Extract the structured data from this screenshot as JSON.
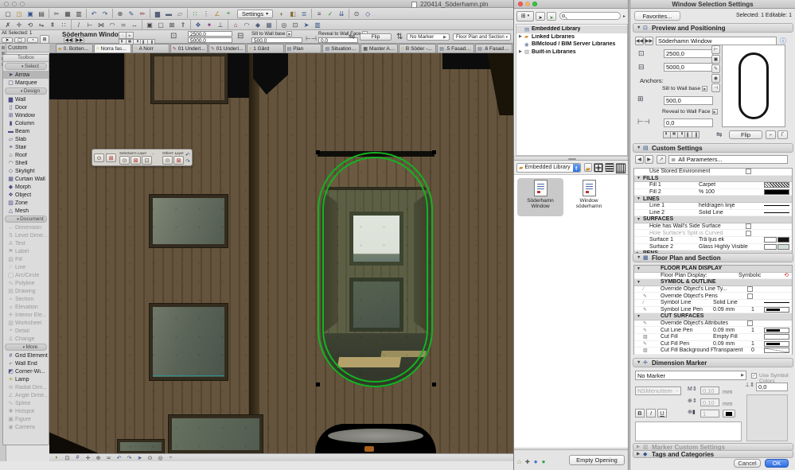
{
  "window": {
    "title": "220414_Söderhamn.pln",
    "settings_label": "Settings"
  },
  "toolbar_row1": [
    "new-file-icon",
    "open-file-icon",
    "save-icon",
    "print-icon",
    "separator",
    "cut-icon",
    "copy-icon",
    "paste-icon",
    "separator",
    "undo-icon",
    "redo-icon",
    "separator",
    "zoom-icon",
    "pick-up-parameters-icon",
    "inject-parameters-icon",
    "separator",
    "wall-tool-dropdown-icon",
    "beam-tool-dropdown-icon",
    "slab-tool-dropdown-icon",
    "separator",
    "snap-points-icon",
    "snap-guides-icon",
    "guide-lines-icon",
    "element-snap-icon"
  ],
  "toolbar_row1b": [
    "virtual-trace-icon",
    "trace-reference-icon",
    "layers-dialog-icon",
    "separator",
    "quick-options-icon",
    "green-check-icon",
    "teamwork-receive-icon",
    "separator",
    "find-select-icon",
    "3d-view-icon"
  ],
  "toolbar_row2": [
    "delete-icon",
    "drag-icon",
    "rotate-icon",
    "mirror-icon",
    "elevate-icon",
    "multiply-icon",
    "separator",
    "split-icon",
    "adjust-icon",
    "intersect-icon",
    "fillet-icon",
    "offset-icon",
    "stretch-icon",
    "separator",
    "group-icon",
    "ungroup-icon",
    "lock-icon",
    "bring-forward-icon",
    "separator",
    "pet-palette-icon",
    "magic-wand-icon",
    "gravity-icon",
    "separator",
    "roof-tool-icon",
    "shell-tool-icon",
    "morph-tool-icon",
    "curtain-wall-tool-icon",
    "separator",
    "show-all-icon",
    "zoom-fit-icon",
    "navigator-icon",
    "organizer-icon"
  ],
  "info_bar": {
    "selected_info": "All Selected: 1",
    "element_name": "Söderhamn Window",
    "width_value": "2500.0",
    "height_value": "5000.0",
    "sill_label": "Sill to Wall base",
    "sill_value": "500.0",
    "reveal_label": "Reveal to Wall Face",
    "reveal_value": "0.0",
    "flip_label": "Flip",
    "marker_value": "No Marker",
    "view_value": "Floor Plan and Section"
  },
  "tabs": [
    {
      "label": "0. Botten...",
      "icon": "folder-icon"
    },
    {
      "label": "Norra fas...",
      "icon": "house-icon",
      "active": true
    },
    {
      "label": "A Norr",
      "icon": "house-icon"
    },
    {
      "label": "01 Underl...",
      "icon": "pencil-icon"
    },
    {
      "label": "01 Underl...",
      "icon": "pencil-icon"
    },
    {
      "label": "1 Gård",
      "icon": "house-icon"
    },
    {
      "label": "Plan",
      "icon": "layout-icon"
    },
    {
      "label": "Situations...",
      "icon": "layout-icon"
    },
    {
      "label": "Master A3...",
      "icon": "master-icon"
    },
    {
      "label": "B Söder -...",
      "icon": "house-icon"
    },
    {
      "label": ".5 Fasad -...",
      "icon": "layout-icon"
    },
    {
      "label": ".6 Fasad -...",
      "icon": "layout-icon"
    }
  ],
  "toolbox": {
    "dock_header": "Custom",
    "panel_title": "Toolbox",
    "rows": [
      {
        "type": "section",
        "label": "Select"
      },
      {
        "type": "tool",
        "label": "Arrow",
        "icon": "arrow-icon",
        "selected": true
      },
      {
        "type": "tool",
        "label": "Marquee",
        "icon": "marquee-icon"
      },
      {
        "type": "section",
        "label": "Design"
      },
      {
        "type": "tool",
        "label": "Wall",
        "icon": "wall-icon"
      },
      {
        "type": "tool",
        "label": "Door",
        "icon": "door-icon"
      },
      {
        "type": "tool",
        "label": "Window",
        "icon": "window-icon"
      },
      {
        "type": "tool",
        "label": "Column",
        "icon": "column-icon"
      },
      {
        "type": "tool",
        "label": "Beam",
        "icon": "beam-icon"
      },
      {
        "type": "tool",
        "label": "Slab",
        "icon": "slab-icon"
      },
      {
        "type": "tool",
        "label": "Stair",
        "icon": "stair-icon"
      },
      {
        "type": "tool",
        "label": "Roof",
        "icon": "roof-icon"
      },
      {
        "type": "tool",
        "label": "Shell",
        "icon": "shell-icon"
      },
      {
        "type": "tool",
        "label": "Skylight",
        "icon": "skylight-icon"
      },
      {
        "type": "tool",
        "label": "Curtain Wall",
        "icon": "curtain-wall-icon"
      },
      {
        "type": "tool",
        "label": "Morph",
        "icon": "morph-icon"
      },
      {
        "type": "tool",
        "label": "Object",
        "icon": "object-icon"
      },
      {
        "type": "tool",
        "label": "Zone",
        "icon": "zone-icon"
      },
      {
        "type": "tool",
        "label": "Mesh",
        "icon": "mesh-icon"
      },
      {
        "type": "section",
        "label": "Document"
      },
      {
        "type": "tool",
        "label": "Dimension",
        "icon": "dimension-icon",
        "disabled": true
      },
      {
        "type": "tool",
        "label": "Level Dime...",
        "icon": "level-dimension-icon",
        "disabled": true
      },
      {
        "type": "tool",
        "label": "Text",
        "icon": "text-icon",
        "disabled": true
      },
      {
        "type": "tool",
        "label": "Label",
        "icon": "label-icon",
        "disabled": true
      },
      {
        "type": "tool",
        "label": "Fill",
        "icon": "fill-icon",
        "disabled": true
      },
      {
        "type": "tool",
        "label": "Line",
        "icon": "line-icon",
        "disabled": true
      },
      {
        "type": "tool",
        "label": "Arc/Circle",
        "icon": "arc-icon",
        "disabled": true
      },
      {
        "type": "tool",
        "label": "Polyline",
        "icon": "polyline-icon",
        "disabled": true
      },
      {
        "type": "tool",
        "label": "Drawing",
        "icon": "drawing-icon",
        "disabled": true
      },
      {
        "type": "tool",
        "label": "Section",
        "icon": "section-icon",
        "disabled": true
      },
      {
        "type": "tool",
        "label": "Elevation",
        "icon": "elevation-icon",
        "disabled": true
      },
      {
        "type": "tool",
        "label": "Interior Ele...",
        "icon": "interior-elevation-icon",
        "disabled": true
      },
      {
        "type": "tool",
        "label": "Worksheet",
        "icon": "worksheet-icon",
        "disabled": true
      },
      {
        "type": "tool",
        "label": "Detail",
        "icon": "detail-icon",
        "disabled": true
      },
      {
        "type": "tool",
        "label": "Change",
        "icon": "change-icon",
        "disabled": true
      },
      {
        "type": "section",
        "label": "More"
      },
      {
        "type": "tool",
        "label": "Grid Element",
        "icon": "grid-element-icon"
      },
      {
        "type": "tool",
        "label": "Wall End",
        "icon": "wall-end-icon"
      },
      {
        "type": "tool",
        "label": "Corner-Wi...",
        "icon": "corner-window-icon"
      },
      {
        "type": "tool",
        "label": "Lamp",
        "icon": "lamp-icon"
      },
      {
        "type": "tool",
        "label": "Radial Dim...",
        "icon": "radial-dimension-icon",
        "disabled": true
      },
      {
        "type": "tool",
        "label": "Angle Dime...",
        "icon": "angle-dimension-icon",
        "disabled": true
      },
      {
        "type": "tool",
        "label": "Spline",
        "icon": "spline-icon",
        "disabled": true
      },
      {
        "type": "tool",
        "label": "Hotspot",
        "icon": "hotspot-icon",
        "disabled": true
      },
      {
        "type": "tool",
        "label": "Figure",
        "icon": "figure-icon",
        "disabled": true
      },
      {
        "type": "tool",
        "label": "Camera",
        "icon": "camera-icon",
        "disabled": true
      }
    ]
  },
  "quick_layers": {
    "selection_label": "Selection's Layer",
    "others_label": "Others' Layer",
    "buttons_left": [
      "eye-icon",
      "lock-red-icon"
    ],
    "buttons_selection": [
      "eye-icon",
      "lock-red-icon",
      "unlock-icon"
    ],
    "buttons_others": [
      "eye-icon",
      "lock-red-icon"
    ],
    "buttons_history": [
      "undo-small-icon",
      "redo-small-icon"
    ]
  },
  "canvas_nav": [
    "virtual-trace-icon",
    "zoom-fit-icon",
    "grid-element-icon",
    "drag-icon",
    "zoom-icon",
    "offset-icon",
    "undo-icon",
    "redo-icon",
    "navigator-icon",
    "find-select-icon",
    "show-all-icon",
    "detail-icon"
  ],
  "library_panel": {
    "tree": [
      {
        "label": "Embedded Library",
        "icon": "embedded-library-icon",
        "selected": true
      },
      {
        "label": "Linked Libraries",
        "icon": "folder-icon",
        "expand": true
      },
      {
        "label": "BIMcloud / BIM Server Libraries",
        "icon": "bimcloud-icon"
      },
      {
        "label": "Built-in Libraries",
        "icon": "builtin-library-icon",
        "expand": true
      }
    ],
    "location_value": "Embedded Library",
    "items": [
      {
        "label": "Söderhamn Window",
        "selected": true
      },
      {
        "label": "Window söderhamn"
      }
    ],
    "bottom_icons": [
      "save-library-part-icon",
      "library-settings-icon",
      "bimcloud-portal-icon",
      "bim-components-icon"
    ],
    "empty_opening_label": "Empty Opening"
  },
  "dialog": {
    "title": "Window Selection Settings",
    "favorites_label": "Favorites...",
    "selection_status": "Selected: 1 Editable: 1",
    "preview_section": "Preview and Positioning",
    "element_name": "Söderhamn Window",
    "width_value": "2500,0",
    "height_value": "5000,0",
    "anchors_label": "Anchors:",
    "sill_anchor_label": "Sill to Wall base",
    "sill_value": "500,0",
    "reveal_anchor_label": "Reveal to Wall Face",
    "reveal_value": "0,0",
    "flip_label": "Flip",
    "custom_section": "Custom Settings",
    "all_parameters_label": "All Parameters...",
    "custom_rows": [
      {
        "type": "check",
        "label": "Use Stored Environment",
        "checked": false
      },
      {
        "type": "group",
        "label": "FILLS",
        "tri": "▼"
      },
      {
        "type": "param",
        "label": "Fill 1",
        "value": "Carpet",
        "swatch": "pattern"
      },
      {
        "type": "param",
        "label": "Fill 2",
        "value": "%  100",
        "swatch": "black"
      },
      {
        "type": "group",
        "label": "LINES",
        "tri": "▼"
      },
      {
        "type": "param",
        "label": "Line 1",
        "value": "heldragen linje",
        "swatch": "line"
      },
      {
        "type": "param",
        "label": "Line 2",
        "value": "Solid Line",
        "swatch": "line"
      },
      {
        "type": "group",
        "label": "SURFACES",
        "tri": "▼"
      },
      {
        "type": "check",
        "label": "Hole has Wall's Side Surface",
        "checked": false
      },
      {
        "type": "check",
        "label": "Hole Surface's Split is Curved",
        "checked": false,
        "disabled": true
      },
      {
        "type": "param",
        "label": "Surface 1",
        "value": "Trä ljus ek",
        "swatch": "dual",
        "swatch2": "#141414"
      },
      {
        "type": "param",
        "label": "Surface 2",
        "value": "Glass Highly Visible",
        "swatch": "dual",
        "swatch2": "#cfe0d4"
      },
      {
        "type": "group",
        "label": "PENS",
        "tri": "▶"
      }
    ],
    "fps_section": "Floor Plan and Section",
    "fps_rows": [
      {
        "type": "group",
        "label": "FLOOR PLAN DISPLAY",
        "tri": "▼"
      },
      {
        "type": "param",
        "label": "Floor Plan Display:",
        "value": "Symbolic",
        "badge": "red-plan-icon"
      },
      {
        "type": "group",
        "label": "SYMBOL & OUTLINE",
        "tri": "▼"
      },
      {
        "type": "check",
        "label": "Override Object's Line Ty...",
        "checked": false,
        "licon": "line-icon"
      },
      {
        "type": "check",
        "label": "Override Object's Pens",
        "checked": false,
        "licon": "pencil-icon"
      },
      {
        "type": "param",
        "label": "Symbol Line",
        "value": "Solid Line",
        "swatch": "line",
        "licon": "line-icon"
      },
      {
        "type": "param",
        "label": "Symbol Line Pen",
        "value": "0.09 mm",
        "value2": "1",
        "swatch": "pen",
        "licon": "pencil-icon"
      },
      {
        "type": "group",
        "label": "CUT SURFACES",
        "tri": "▼"
      },
      {
        "type": "check",
        "label": "Override Object's Attributes",
        "checked": false,
        "licon": "pencil-icon"
      },
      {
        "type": "param",
        "label": "Cut Line Pen",
        "value": "0.09 mm",
        "value2": "1",
        "swatch": "pen",
        "licon": "pencil-icon"
      },
      {
        "type": "param",
        "label": "Cut Fill",
        "value": "Empty Fill",
        "swatch": "white",
        "licon": "fill-icon"
      },
      {
        "type": "param",
        "label": "Cut Fill Pen",
        "value": "0.09 mm",
        "value2": "1",
        "swatch": "pen",
        "licon": "pencil-icon",
        "disabled": false
      },
      {
        "type": "param",
        "label": "Cut Fill Background Pen",
        "value": "Transparent",
        "value2": "0",
        "swatch": "transparent",
        "licon": "fill-icon"
      }
    ],
    "dim_section": "Dimension Marker",
    "marker_value": "No Marker",
    "use_symbol_colors_label": "Use Symbol Colors",
    "font_value": "NSMenuItem",
    "size_value": "0,10",
    "size_unit": "mm",
    "size_value2": "0,10",
    "size_unit2": "mm",
    "pen_value": "1",
    "offset_value": "0,0",
    "bold_label": "B",
    "italic_label": "I",
    "underline_label": "U",
    "marker_custom_section": "Marker Custom Settings",
    "tags_section": "Tags and Categories",
    "cancel_label": "Cancel",
    "ok_label": "OK"
  },
  "colors": {
    "selection_green": "#12b41f",
    "ok_blue": "#2f6fe0"
  }
}
